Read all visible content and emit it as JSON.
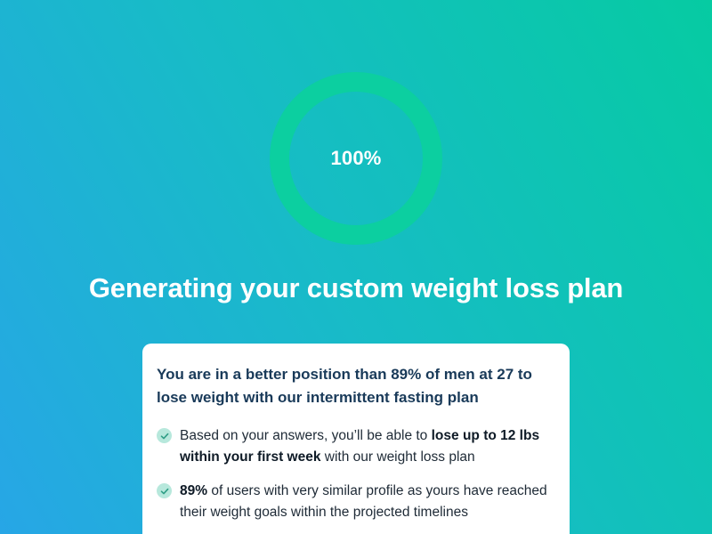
{
  "progress": {
    "value": 1.0,
    "label": "100%",
    "ring_color": "#0ccfa0"
  },
  "headline": "Generating your custom weight loss plan",
  "card": {
    "title": "You are in a better position than 89% of men at 27 to lose weight with our intermittent fasting plan",
    "benefits": [
      {
        "icon": "check-icon",
        "before": "Based on your answers, you’ll be able to ",
        "highlight": "lose up to 12 lbs within your first week",
        "after": " with our weight loss plan"
      },
      {
        "icon": "check-icon",
        "before": "",
        "highlight": "89%",
        "after": " of users with very similar profile as yours have reached their weight goals within the projected timelines"
      }
    ]
  },
  "colors": {
    "gradient_start": "#27a6e6",
    "gradient_end": "#06cba2",
    "card_title": "#193a59",
    "check_bg": "#b7e8dc",
    "check_mark": "#2f9e86"
  }
}
